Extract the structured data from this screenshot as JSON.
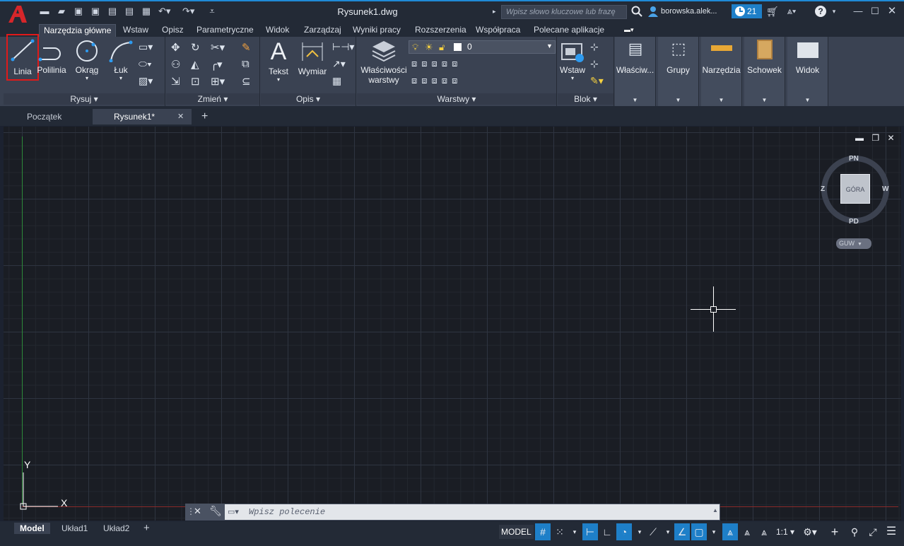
{
  "titlebar": {
    "document": "Rysunek1.dwg",
    "search_placeholder": "Wpisz słowo kluczowe lub frazę",
    "user": "borowska.alek...",
    "notifications": "21"
  },
  "ribbon_tabs": [
    "Narzędzia główne",
    "Wstaw",
    "Opisz",
    "Parametryczne",
    "Widok",
    "Zarządzaj",
    "Wyniki pracy",
    "Rozszerzenia",
    "Współpraca",
    "Polecane aplikacje"
  ],
  "panels": {
    "rysuj": {
      "title": "Rysuj",
      "buttons": [
        "Linia",
        "Polilinia",
        "Okrąg",
        "Łuk"
      ]
    },
    "zmien": {
      "title": "Zmień"
    },
    "opis": {
      "title": "Opis",
      "buttons": [
        "Tekst",
        "Wymiar"
      ]
    },
    "warstwy": {
      "title": "Warstwy",
      "props": "Właściwości warstwy",
      "layer": "0"
    },
    "blok": {
      "title": "Blok",
      "insert": "Wstaw"
    },
    "collapsed": [
      "Właściw...",
      "Grupy",
      "Narzędzia",
      "Schowek",
      "Widok"
    ]
  },
  "doc_tabs": [
    "Początek",
    "Rysunek1*"
  ],
  "viewcube": {
    "n": "PN",
    "s": "PD",
    "w": "Z",
    "e": "W",
    "face": "GÓRA",
    "ucs": "GUW"
  },
  "ucs_icon": {
    "x": "X",
    "y": "Y"
  },
  "command": {
    "placeholder": "Wpisz polecenie"
  },
  "layout_tabs": [
    "Model",
    "Układ1",
    "Układ2"
  ],
  "status": {
    "model": "MODEL",
    "scale": "1:1"
  },
  "colors": {
    "accent": "#1e7fc8",
    "highlight": "#e01a1a",
    "background": "#1a1d24"
  }
}
